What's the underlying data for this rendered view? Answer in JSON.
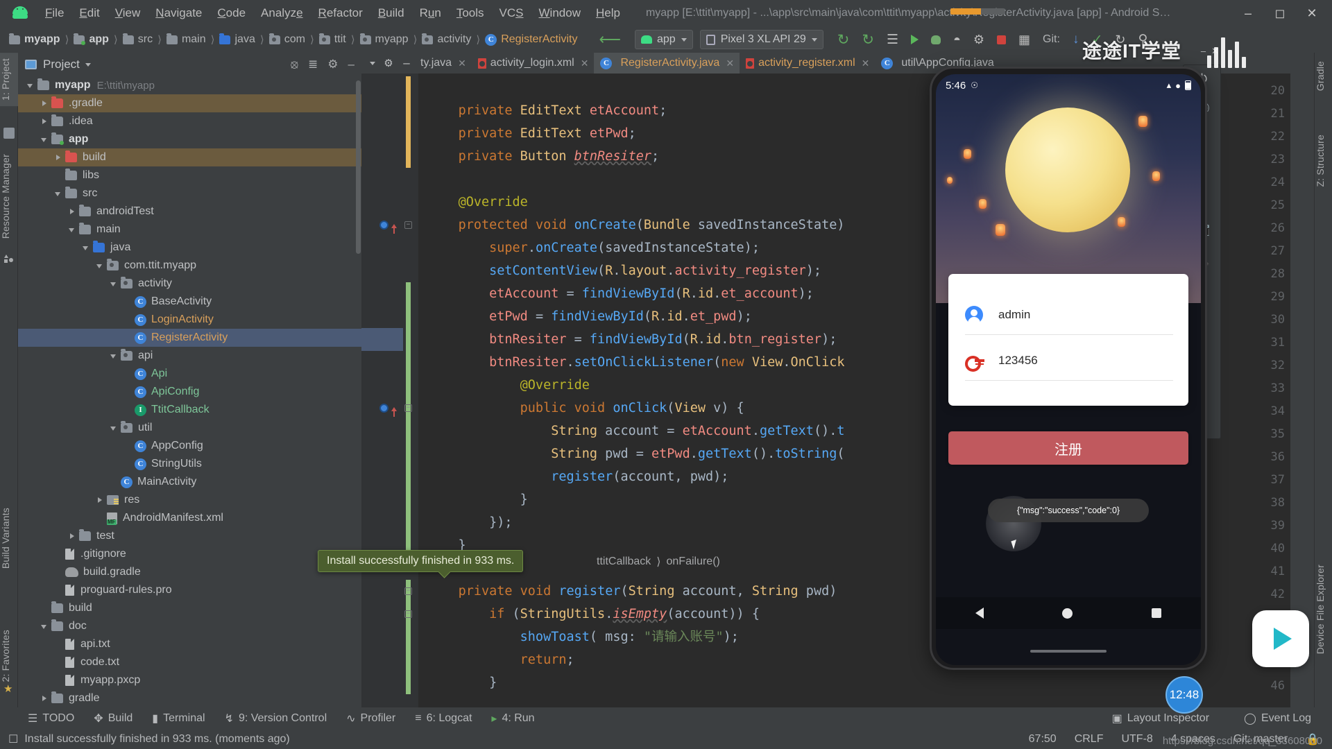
{
  "window": {
    "title": "myapp [E:\\ttit\\myapp] - ...\\app\\src\\main\\java\\com\\ttit\\myapp\\activity\\RegisterActivity.java [app] - Android Studio",
    "minimize": "—",
    "maximize": "❐",
    "close": "✕",
    "logo": "android-logo"
  },
  "menu": [
    "File",
    "Edit",
    "View",
    "Navigate",
    "Code",
    "Analyze",
    "Refactor",
    "Build",
    "Run",
    "Tools",
    "VCS",
    "Window",
    "Help"
  ],
  "breadcrumb": [
    {
      "label": "myapp",
      "icon": "folder-module",
      "bold": true
    },
    {
      "label": "app",
      "icon": "folder-module-dot",
      "bold": true
    },
    {
      "label": "src",
      "icon": "folder"
    },
    {
      "label": "main",
      "icon": "folder"
    },
    {
      "label": "java",
      "icon": "folder-blue"
    },
    {
      "label": "com",
      "icon": "folder-package"
    },
    {
      "label": "ttit",
      "icon": "folder-package"
    },
    {
      "label": "myapp",
      "icon": "folder-package"
    },
    {
      "label": "activity",
      "icon": "folder-package"
    },
    {
      "label": "RegisterActivity",
      "icon": "class-icon"
    }
  ],
  "toolbar": {
    "module_selector": "app",
    "device_selector": "Pixel 3 XL API 29",
    "git_label": "Git:",
    "run_tooltip": "Run",
    "stop_tooltip": "Stop"
  },
  "project_panel": {
    "title": "Project",
    "locate_icon": "crosshair-icon",
    "collapse_icon": "collapse-all-icon",
    "settings_icon": "gear-icon",
    "hide_icon": "minimize-icon",
    "tree": [
      {
        "label": "myapp",
        "sub": "E:\\ttit\\myapp",
        "depth": 0,
        "arrow": "down",
        "icon": "folder-module",
        "bold": true
      },
      {
        "label": ".gradle",
        "depth": 1,
        "arrow": "right",
        "icon": "folder-red",
        "hl": "brown"
      },
      {
        "label": ".idea",
        "depth": 1,
        "arrow": "right",
        "icon": "folder"
      },
      {
        "label": "app",
        "depth": 1,
        "arrow": "down",
        "icon": "folder-module-dot",
        "bold": true
      },
      {
        "label": "build",
        "depth": 2,
        "arrow": "right",
        "icon": "folder-red",
        "hl": "brown"
      },
      {
        "label": "libs",
        "depth": 2,
        "arrow": "none",
        "icon": "folder"
      },
      {
        "label": "src",
        "depth": 2,
        "arrow": "down",
        "icon": "folder"
      },
      {
        "label": "androidTest",
        "depth": 3,
        "arrow": "right",
        "icon": "folder"
      },
      {
        "label": "main",
        "depth": 3,
        "arrow": "down",
        "icon": "folder"
      },
      {
        "label": "java",
        "depth": 4,
        "arrow": "down",
        "icon": "folder-blue"
      },
      {
        "label": "com.ttit.myapp",
        "depth": 5,
        "arrow": "down",
        "icon": "folder-package"
      },
      {
        "label": "activity",
        "depth": 6,
        "arrow": "down",
        "icon": "folder-package"
      },
      {
        "label": "BaseActivity",
        "depth": 7,
        "arrow": "none",
        "icon": "class-icon"
      },
      {
        "label": "LoginActivity",
        "depth": 7,
        "arrow": "none",
        "icon": "class-icon",
        "color": "orange"
      },
      {
        "label": "RegisterActivity",
        "depth": 7,
        "arrow": "none",
        "icon": "class-icon",
        "color": "orange",
        "hl": "sel"
      },
      {
        "label": "api",
        "depth": 6,
        "arrow": "down",
        "icon": "folder-package"
      },
      {
        "label": "Api",
        "depth": 7,
        "arrow": "none",
        "icon": "class-icon",
        "color": "green"
      },
      {
        "label": "ApiConfig",
        "depth": 7,
        "arrow": "none",
        "icon": "class-icon",
        "color": "green"
      },
      {
        "label": "TtitCallback",
        "depth": 7,
        "arrow": "none",
        "icon": "interface-icon",
        "color": "green"
      },
      {
        "label": "util",
        "depth": 6,
        "arrow": "down",
        "icon": "folder-package"
      },
      {
        "label": "AppConfig",
        "depth": 7,
        "arrow": "none",
        "icon": "class-icon"
      },
      {
        "label": "StringUtils",
        "depth": 7,
        "arrow": "none",
        "icon": "class-icon"
      },
      {
        "label": "MainActivity",
        "depth": 6,
        "arrow": "none",
        "icon": "class-icon"
      },
      {
        "label": "res",
        "depth": 5,
        "arrow": "right",
        "icon": "folder-res"
      },
      {
        "label": "AndroidManifest.xml",
        "depth": 5,
        "arrow": "none",
        "icon": "manifest-icon"
      },
      {
        "label": "test",
        "depth": 3,
        "arrow": "right",
        "icon": "folder"
      },
      {
        "label": ".gitignore",
        "depth": 2,
        "arrow": "none",
        "icon": "gitignore-icon"
      },
      {
        "label": "build.gradle",
        "depth": 2,
        "arrow": "none",
        "icon": "gradle-icon"
      },
      {
        "label": "proguard-rules.pro",
        "depth": 2,
        "arrow": "none",
        "icon": "file-icon"
      },
      {
        "label": "build",
        "depth": 1,
        "arrow": "none",
        "icon": "folder"
      },
      {
        "label": "doc",
        "depth": 1,
        "arrow": "down",
        "icon": "folder"
      },
      {
        "label": "api.txt",
        "depth": 2,
        "arrow": "none",
        "icon": "file-icon"
      },
      {
        "label": "code.txt",
        "depth": 2,
        "arrow": "none",
        "icon": "file-icon"
      },
      {
        "label": "myapp.pxcp",
        "depth": 2,
        "arrow": "none",
        "icon": "file-icon"
      },
      {
        "label": "gradle",
        "depth": 1,
        "arrow": "right",
        "icon": "folder"
      }
    ]
  },
  "left_rail": [
    "1: Project",
    "Resource Manager",
    "Build Variants",
    "2: Favorites"
  ],
  "right_rail": [
    "Gradle",
    "Z: Structure",
    "Device File Explorer"
  ],
  "tabs": [
    {
      "label": "ty.java",
      "icon": "class-icon",
      "active": false
    },
    {
      "label": "activity_login.xml",
      "icon": "xml-icon",
      "active": false
    },
    {
      "label": "RegisterActivity.java",
      "icon": "class-icon",
      "active": true
    },
    {
      "label": "activity_register.xml",
      "icon": "xml-icon",
      "active": false
    },
    {
      "label": "util\\AppConfig.java",
      "icon": "class-icon",
      "active": false
    }
  ],
  "editor": {
    "first_line": 20,
    "lines": [
      {
        "n": 20,
        "html": "",
        "marker": "yellow"
      },
      {
        "n": 21,
        "html": "    <span class='k'>private</span> <span class='ty'>EditText</span> <span class='fl'>etAccount</span>;",
        "marker": "yellow"
      },
      {
        "n": 22,
        "html": "    <span class='k'>private</span> <span class='ty'>EditText</span> <span class='fl'>etPwd</span>;",
        "marker": "yellow"
      },
      {
        "n": 23,
        "html": "    <span class='k'>private</span> <span class='ty'>Button</span> <span class='it'>btnResiter</span>;",
        "marker": "yellow"
      },
      {
        "n": 24,
        "html": ""
      },
      {
        "n": 25,
        "html": "    <span class='an'>@Override</span>"
      },
      {
        "n": 26,
        "html": "    <span class='k'>protected</span> <span class='k'>void</span> <span class='fn'>onCreate</span>(<span class='ty'>Bundle</span> savedInstanceState)",
        "gutter": "override-breakpoint"
      },
      {
        "n": 27,
        "html": "        <span class='k'>super</span>.<span class='fn'>onCreate</span>(savedInstanceState);"
      },
      {
        "n": 28,
        "html": "        <span class='fn'>setContentView</span>(<span class='ty'>R</span>.<span class='ty'>layout</span>.<span class='fl'>activity_register</span>);"
      },
      {
        "n": 29,
        "html": "        <span class='fl'>etAccount</span> = <span class='fn'>findViewById</span>(<span class='ty'>R</span>.<span class='ty'>id</span>.<span class='fl'>et_account</span>);",
        "marker": "green"
      },
      {
        "n": 30,
        "html": "        <span class='fl'>etPwd</span> = <span class='fn'>findViewById</span>(<span class='ty'>R</span>.<span class='ty'>id</span>.<span class='fl'>et_pwd</span>);",
        "marker": "green"
      },
      {
        "n": 31,
        "html": "        <span class='fl'>btnResiter</span> = <span class='fn'>findViewById</span>(<span class='ty'>R</span>.<span class='ty'>id</span>.<span class='fl'>btn_register</span>);",
        "marker": "green",
        "hl": "sel"
      },
      {
        "n": 32,
        "html": "        <span class='fl'>btnResiter</span>.<span class='fn'>setOnClickListener</span>(<span class='k'>new</span> <span class='ty'>View</span>.<span class='ty'>OnClick</span>",
        "marker": "green"
      },
      {
        "n": 33,
        "html": "            <span class='an'>@Override</span>",
        "marker": "green"
      },
      {
        "n": 34,
        "html": "            <span class='k'>public</span> <span class='k'>void</span> <span class='fn'>onClick</span>(<span class='ty'>View</span> v) {",
        "marker": "green",
        "gutter": "override-breakpoint"
      },
      {
        "n": 35,
        "html": "                <span class='ty'>String</span> account = <span class='fl'>etAccount</span>.<span class='fn'>getText</span>().<span class='fn'>t</span>",
        "marker": "green"
      },
      {
        "n": 36,
        "html": "                <span class='ty'>String</span> pwd = <span class='fl'>etPwd</span>.<span class='fn'>getText</span>().<span class='fn'>toString</span>(",
        "marker": "green"
      },
      {
        "n": 37,
        "html": "                <span class='fn'>register</span>(account, pwd);",
        "marker": "green"
      },
      {
        "n": 38,
        "html": "            }",
        "marker": "green"
      },
      {
        "n": 39,
        "html": "        });",
        "marker": "green"
      },
      {
        "n": 40,
        "html": "    }",
        "marker": "green"
      },
      {
        "n": 41,
        "html": ""
      },
      {
        "n": 42,
        "html": "    <span class='k'>private</span> <span class='k'>void</span> <span class='fn'>register</span>(<span class='ty'>String</span> account, <span class='ty'>String</span> pwd)",
        "marker": "green",
        "gutter": "fold"
      },
      {
        "n": 43,
        "html": "        <span class='k'>if</span> (<span class='ty'>StringUtils</span>.<span class='it'>isEmpty</span>(account)) {",
        "marker": "green",
        "gutter": "fold"
      },
      {
        "n": 44,
        "html": "            <span class='fn'>showToast</span>( msg: <span class='st'>\"请输入账号\"</span>);",
        "marker": "green"
      },
      {
        "n": 45,
        "html": "            <span class='k'>return</span>;",
        "marker": "green"
      },
      {
        "n": 46,
        "html": "        }",
        "marker": "green"
      }
    ]
  },
  "tooltip": {
    "text": "Install successfully finished in 933 ms."
  },
  "editor_breadcrumb": [
    "ttitCallback",
    "onFailure()"
  ],
  "emulator": {
    "status_time": "5:46",
    "card": {
      "account_value": "admin",
      "account_icon": "person-icon",
      "password_value": "123456",
      "password_icon": "key-icon"
    },
    "register_button": "注册",
    "toast": "{\"msg\":\"success\",\"code\":0}",
    "tools": [
      "power-icon",
      "volume-up-icon",
      "volume-down-icon",
      "rotate-left-icon",
      "rotate-right-icon",
      "screenshot-icon",
      "zoom-icon",
      "back-icon",
      "home-icon",
      "overview-icon",
      "more-icon"
    ],
    "nav": [
      "back-triangle-icon",
      "home-circle-icon",
      "overview-square-icon"
    ]
  },
  "bottom_bar": {
    "items": [
      {
        "label": "TODO",
        "icon": "todo-icon"
      },
      {
        "label": "Build",
        "icon": "build-hammer-icon"
      },
      {
        "label": "Terminal",
        "icon": "terminal-icon"
      },
      {
        "label": "9: Version Control",
        "icon": "vcs-icon"
      },
      {
        "label": "Profiler",
        "icon": "profiler-icon"
      },
      {
        "label": "6: Logcat",
        "icon": "logcat-icon"
      },
      {
        "label": "4: Run",
        "icon": "run-icon"
      }
    ],
    "right": [
      {
        "label": "Layout Inspector",
        "icon": "layout-inspector-icon"
      },
      {
        "label": "Event Log",
        "icon": "event-log-icon"
      }
    ]
  },
  "status_bar": {
    "message": "Install successfully finished in 933 ms. (moments ago)",
    "message_icon": "notification-icon",
    "caret": "67:50",
    "line_sep": "CRLF",
    "encoding": "UTF-8",
    "indent": "4 spaces",
    "branch": "Git: master",
    "lock_icon": "lock-icon"
  },
  "watermark": {
    "text": "途途IT学堂",
    "play_icon": "play-button-icon",
    "time_badge": "12:48",
    "url": "https://blog.csdn.net/qq_33608000"
  },
  "colors": {
    "accent_orange": "#e8992e",
    "selection_blue": "#4b5a75",
    "highlight_brown": "#6b5b3e",
    "editor_bg": "#2b2b2b",
    "panel_bg": "#3c3f41",
    "register_button": "#c0595e",
    "green_marker": "#8ec07c",
    "yellow_marker": "#e2b55a"
  }
}
